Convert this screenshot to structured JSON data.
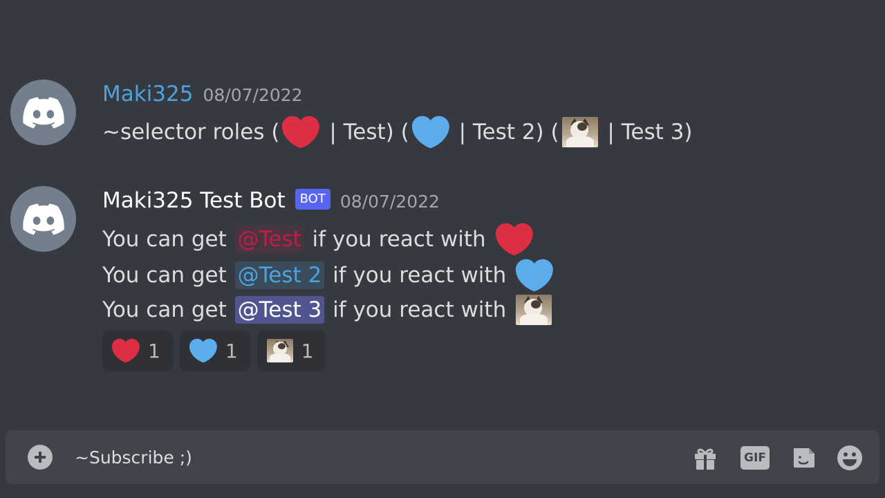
{
  "messages": [
    {
      "author": "Maki325",
      "timestamp": "08/07/2022",
      "content": {
        "prefix": "~selector roles (",
        "sep1": " | Test) (",
        "sep2": " | Test 2) (",
        "sep3": " | Test 3)"
      },
      "author_color": "#4ca2df"
    },
    {
      "author": "Maki325 Test Bot",
      "bot_tag": "BOT",
      "timestamp": "08/07/2022",
      "lines": [
        {
          "pre": "You can get ",
          "mention": "@Test",
          "post": " if you react with ",
          "emoji": "heart-red"
        },
        {
          "pre": "You can get ",
          "mention": "@Test 2",
          "post": " if you react with ",
          "emoji": "heart-blue"
        },
        {
          "pre": "You can get ",
          "mention": "@Test 3",
          "post": " if you react with ",
          "emoji": "cat"
        }
      ],
      "reactions": [
        {
          "emoji": "heart-red",
          "count": "1"
        },
        {
          "emoji": "heart-blue",
          "count": "1"
        },
        {
          "emoji": "cat",
          "count": "1"
        }
      ]
    }
  ],
  "composer": {
    "value": "~Subscribe ;)",
    "buttons": [
      "gift-icon",
      "gif-button",
      "sticker-icon",
      "emoji-icon"
    ],
    "gif_label": "GIF"
  },
  "colors": {
    "background": "#36393f",
    "heart_red": "#dd2e44",
    "heart_blue": "#5dadec",
    "mention_red": "#c21a4a",
    "mention_blue": "#4ca2df",
    "mention_purple_bg": "#51558f",
    "bot_tag": "#5865f2"
  }
}
